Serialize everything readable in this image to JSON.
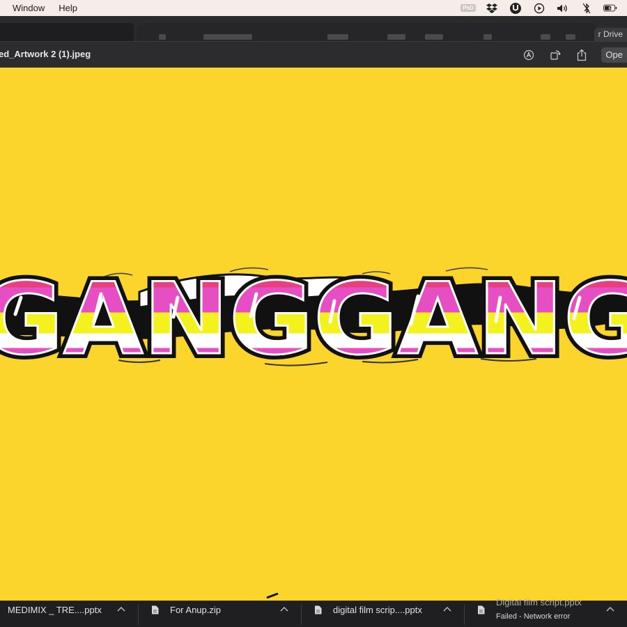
{
  "menubar": {
    "items": [
      "Window",
      "Help"
    ],
    "tray_icons": [
      "phd-badge-icon",
      "dropbox-icon",
      "torrent-icon",
      "play-icon",
      "volume-icon",
      "bluetooth-icon",
      "battery-icon"
    ],
    "badge_text": "PhD"
  },
  "background_window": {
    "drive_label": "r Drive"
  },
  "preview": {
    "document_title": "ed_Artwork 2 (1).jpeg",
    "open_button": "Ope",
    "toolbar_icons": [
      "markup-icon",
      "rotate-icon",
      "share-icon"
    ]
  },
  "artwork": {
    "text": "GANGGANG",
    "colors": {
      "background": "#fcd52c",
      "pink": "#e64fc3",
      "magenta": "#e83f7e",
      "yellow": "#f4f21e",
      "black": "#111111",
      "white": "#ffffff"
    }
  },
  "downloads": [
    {
      "name": "MEDIMIX _ TRE....pptx",
      "status": ""
    },
    {
      "name": "For Anup.zip",
      "status": ""
    },
    {
      "name": "digital film scrip....pptx",
      "status": ""
    },
    {
      "name": "Digital film script.pptx",
      "status": "Failed - Network error"
    }
  ]
}
